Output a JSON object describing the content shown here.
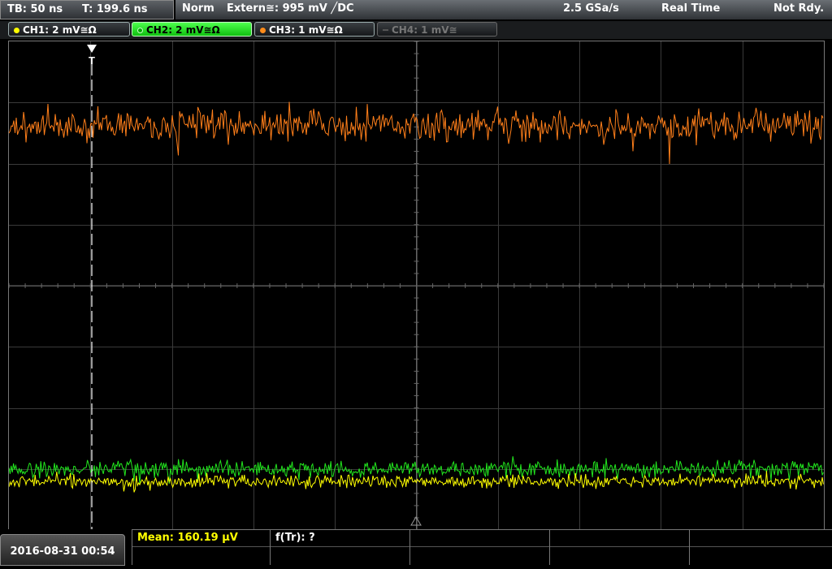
{
  "header": {
    "timebase": "TB: 50 ns",
    "trigger_time": "T: 199.6 ns",
    "trigger_mode": "Norm",
    "trigger_source": "Extern≅: 995 mV ╱DC",
    "sample_rate": "2.5 GSa/s",
    "acq_mode": "Real Time",
    "status": "Not Rdy."
  },
  "channels": [
    {
      "label": "CH1: 2 mV≅Ω",
      "color": "#ffff00"
    },
    {
      "label": "CH2: 2 mV≅Ω",
      "color": "#00ff00"
    },
    {
      "label": "CH3: 1 mV≅Ω",
      "color": "#ff8c1a"
    },
    {
      "label": "CH4: 1 mV≅",
      "color": "#777777"
    }
  ],
  "measurements": {
    "mean": "Mean: 160.19 µV",
    "ftr": "f(Tr): ?"
  },
  "datetime": "2016-08-31 00:54",
  "trace_colors": {
    "orange": "#ff7f1a",
    "green": "#22e61e",
    "yellow": "#ffff00"
  },
  "markers": {
    "trigger_label": "T"
  }
}
